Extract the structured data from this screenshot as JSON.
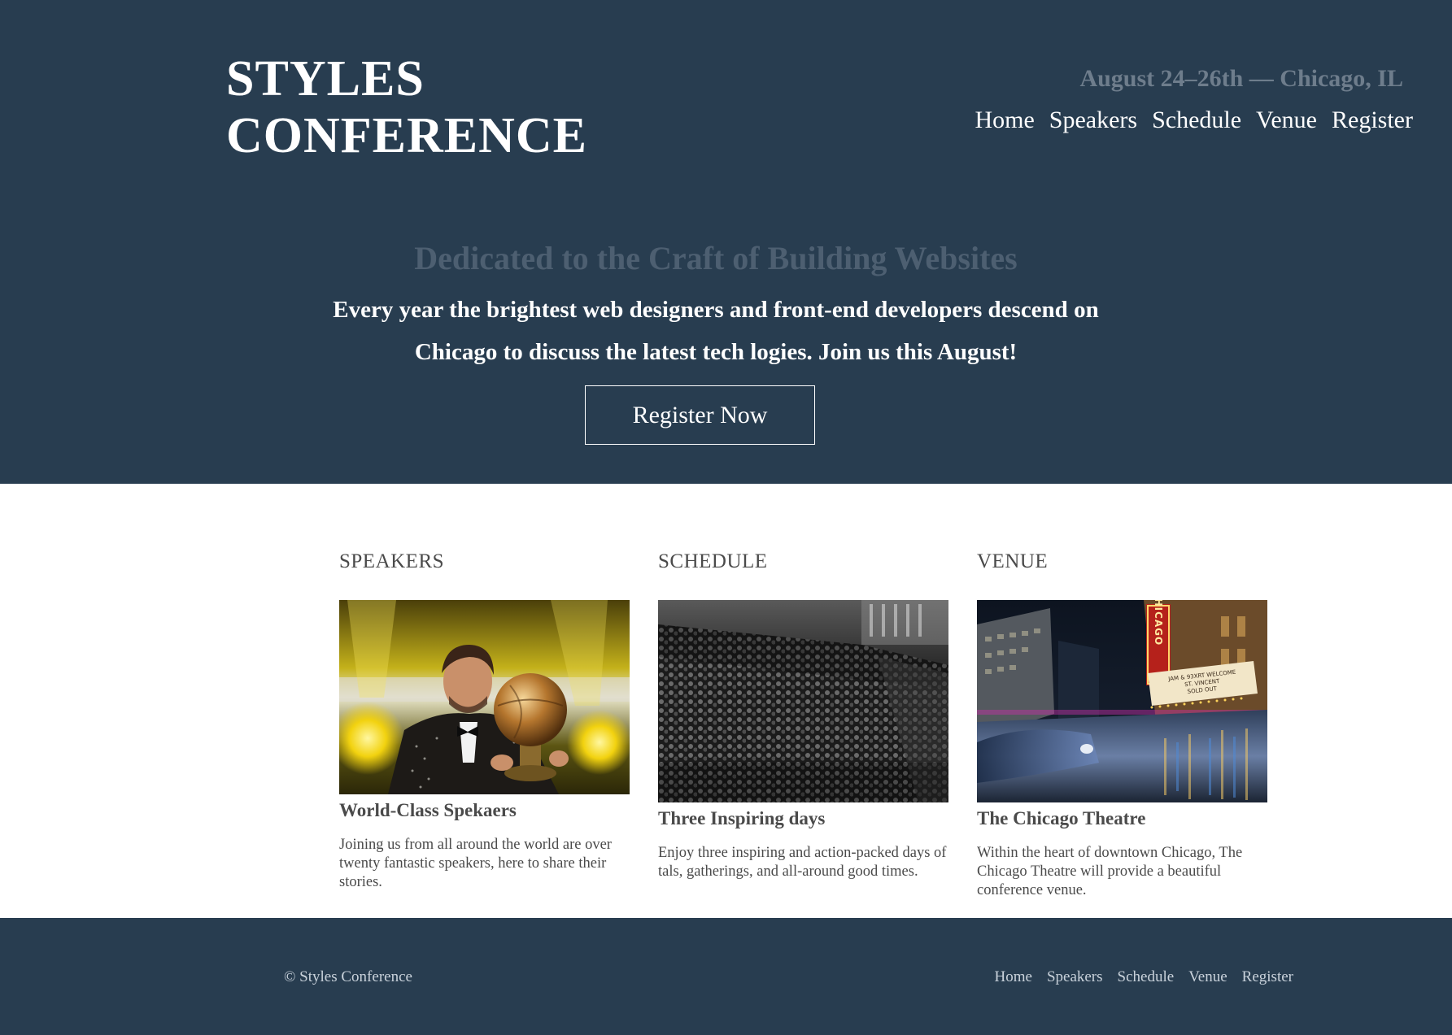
{
  "header": {
    "logo_line1": "STYLES",
    "logo_line2": "CONFERENCE",
    "dateline": "August 24–26th — Chicago, IL",
    "nav": [
      "Home",
      "Speakers",
      "Schedule",
      "Venue",
      "Register"
    ]
  },
  "hero": {
    "title": "Dedicated to the Craft of Building Websites",
    "lead": "Every year the brightest web designers and front-end developers descend on Chicago to discuss the latest tech logies. Join us this August!",
    "button_label": "Register Now"
  },
  "columns": [
    {
      "heading": "SPEAKERS",
      "image": "speaker-with-trophy-photo",
      "title": "World-Class Spekaers",
      "text": "Joining us from all around the world are over twenty fantastic speakers, here to share their stories."
    },
    {
      "heading": "SCHEDULE",
      "image": "auditorium-audience-photo",
      "title": "Three Inspiring days",
      "text": "Enjoy three inspiring and action-packed days of tals, gatherings, and all-around good times."
    },
    {
      "heading": "VENUE",
      "image": "chicago-theatre-night-photo",
      "title": "The Chicago Theatre",
      "text": "Within the heart of downtown Chicago, The Chicago Theatre will provide a beautiful conference venue."
    }
  ],
  "footer": {
    "copyright": "© Styles Conference",
    "nav": [
      "Home",
      "Speakers",
      "Schedule",
      "Venue",
      "Register"
    ]
  },
  "photo_signage": {
    "vertical_sign": "CHICAGO",
    "marquee_line1": "JAM & 93XRT WELCOME",
    "marquee_line2": "ST. VINCENT",
    "marquee_line3": "SOLD OUT"
  },
  "colors": {
    "header_bg": "#283d50",
    "hero_title": "#4d5f71",
    "dateline": "#6e7d8c",
    "body_text": "#4a4a4a",
    "footer_text": "#c9d2db"
  }
}
